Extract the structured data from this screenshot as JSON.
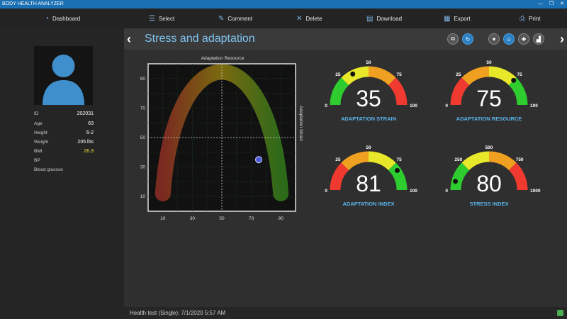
{
  "app": {
    "title": "BODY HEALTH ANALYZER"
  },
  "window_controls": [
    "—",
    "❐",
    "✕"
  ],
  "toolbar": {
    "dashboard": "Dashboard",
    "select": "Select",
    "comment": "Comment",
    "delete": "Delete",
    "download": "Download",
    "export": "Export",
    "print": "Print"
  },
  "patient": {
    "id_label": "ID",
    "id": "202031",
    "age_label": "Age",
    "age": "63",
    "height_label": "Height",
    "height": "6-2",
    "weight_label": "Weight",
    "weight": "205 lbs",
    "bmi_label": "BMI",
    "bmi": "26.3",
    "bp_label": "BP",
    "bp": "",
    "glucose_label": "Blood glucose",
    "glucose": ""
  },
  "page": {
    "title": "Stress and adaptation"
  },
  "chart_data": {
    "type": "scatter",
    "title": "Adaptation Resource",
    "ylabel": "Adaptation Strain",
    "xlim": [
      0,
      100
    ],
    "ylim": [
      0,
      100
    ],
    "x_ticks": [
      "10",
      "30",
      "50",
      "70",
      "90"
    ],
    "y_ticks": [
      "10",
      "30",
      "50",
      "70",
      "90"
    ],
    "point": {
      "x": 75,
      "y": 35
    },
    "grid": true,
    "crosshair": [
      50,
      50
    ]
  },
  "gauges": [
    {
      "name": "ADAPTATION STRAIN",
      "value": "35",
      "min": "0",
      "max": "100",
      "q1": "25",
      "mid": "50",
      "q3": "75",
      "fraction": 0.35,
      "colors": [
        "#2ecc2e",
        "#e8e82a",
        "#f0a020",
        "#f03a30"
      ]
    },
    {
      "name": "ADAPTATION RESOURCE",
      "value": "75",
      "min": "0",
      "max": "100",
      "q1": "25",
      "mid": "50",
      "q3": "75",
      "fraction": 0.75,
      "colors": [
        "#f03a30",
        "#f0a020",
        "#e8e82a",
        "#2ecc2e"
      ]
    },
    {
      "name": "ADAPTATION INDEX",
      "value": "81",
      "min": "0",
      "max": "100",
      "q1": "25",
      "mid": "50",
      "q3": "75",
      "fraction": 0.81,
      "colors": [
        "#f03a30",
        "#f0a020",
        "#e8e82a",
        "#2ecc2e"
      ]
    },
    {
      "name": "STRESS INDEX",
      "value": "80",
      "min": "0",
      "max": "1000",
      "q1": "250",
      "mid": "500",
      "q3": "750",
      "fraction": 0.08,
      "colors": [
        "#2ecc2e",
        "#e8e82a",
        "#f0a020",
        "#f03a30"
      ]
    }
  ],
  "status": {
    "text": "Health test (Single):  7/1/2020 5:57 AM"
  }
}
